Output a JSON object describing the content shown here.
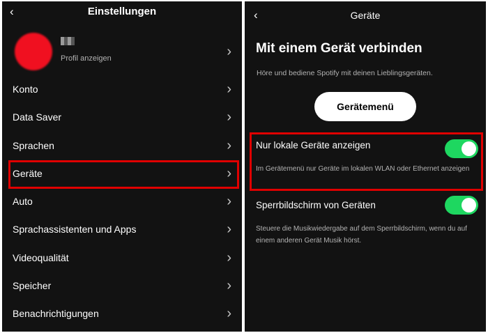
{
  "left": {
    "back_icon": "‹",
    "title": "Einstellungen",
    "profile": {
      "link_label": "Profil anzeigen"
    },
    "chevron": "›",
    "items": [
      {
        "label": "Konto"
      },
      {
        "label": "Data Saver"
      },
      {
        "label": "Sprachen"
      },
      {
        "label": "Geräte"
      },
      {
        "label": "Auto"
      },
      {
        "label": "Sprachassistenten und Apps"
      },
      {
        "label": "Videoqualität"
      },
      {
        "label": "Speicher"
      },
      {
        "label": "Benachrichtigungen"
      }
    ]
  },
  "right": {
    "back_icon": "‹",
    "title": "Geräte",
    "heading": "Mit einem Gerät verbinden",
    "description": "Höre und bediene Spotify mit deinen Lieblingsgeräten.",
    "devices_button": "Gerätemenü",
    "settings": [
      {
        "label": "Nur lokale Geräte anzeigen",
        "description": "Im Gerätemenü nur Geräte im lokalen WLAN oder Ethernet anzeigen",
        "enabled": true
      },
      {
        "label": "Sperrbildschirm von Geräten",
        "description": "Steuere die Musikwiedergabe auf dem Sperrbildschirm, wenn du auf einem anderen Gerät Musik hörst.",
        "enabled": true
      }
    ]
  },
  "colors": {
    "background": "#121212",
    "accent": "#1ed760",
    "highlight": "#e00000",
    "avatar": "#f01020"
  }
}
